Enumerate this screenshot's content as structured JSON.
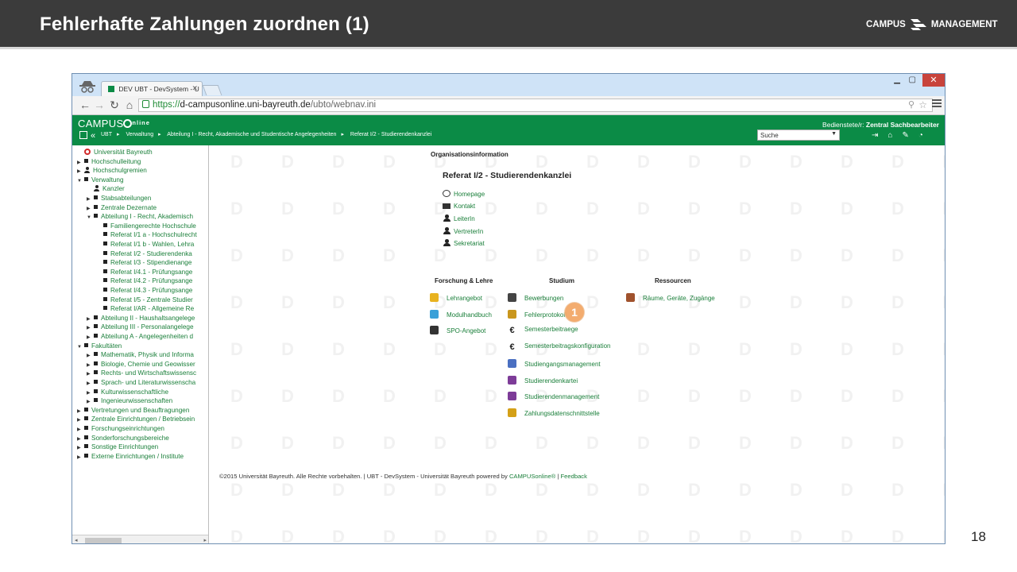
{
  "slide": {
    "title": "Fehlerhafte Zahlungen zuordnen (1)",
    "logo_left": "CAMPUS",
    "logo_right": "MANAGEMENT",
    "page_number": "18"
  },
  "browser": {
    "tab_title": "DEV UBT - DevSystem - U",
    "url_scheme": "https://",
    "url_host": "d-campusonline.uni-bayreuth.de",
    "url_path": "/ubto/webnav.ini"
  },
  "campusonline": {
    "brand": "CAMPUS",
    "brand_suffix": "nline",
    "breadcrumb": [
      "UBT",
      "Verwaltung",
      "Abteilung I - Recht, Akademische und Studentische Angelegenheiten",
      "Referat I/2 - Studierendenkanzlei"
    ],
    "user_role": "Bedienstete/r:",
    "user_name": "Zentral Sachbearbeiter",
    "search_label": "Suche"
  },
  "tree": [
    {
      "label": "Universität Bayreuth",
      "level": 0,
      "icon": "university-logo-icon",
      "toggle": ""
    },
    {
      "label": "Hochschulleitung",
      "level": 0,
      "icon": "square-icon",
      "toggle": "▶"
    },
    {
      "label": "Hochschulgremien",
      "level": 0,
      "icon": "group-icon",
      "toggle": "▶"
    },
    {
      "label": "Verwaltung",
      "level": 0,
      "icon": "square-icon",
      "toggle": "▼"
    },
    {
      "label": "Kanzler",
      "level": 1,
      "icon": "person-icon",
      "toggle": ""
    },
    {
      "label": "Stabsabteilungen",
      "level": 1,
      "icon": "square-icon",
      "toggle": "▶"
    },
    {
      "label": "Zentrale Dezernate",
      "level": 1,
      "icon": "square-icon",
      "toggle": "▶"
    },
    {
      "label": "Abteilung I - Recht, Akademisch",
      "level": 1,
      "icon": "square-icon",
      "toggle": "▼"
    },
    {
      "label": "Familiengerechte Hochschule",
      "level": 2,
      "icon": "square-icon",
      "toggle": ""
    },
    {
      "label": "Referat I/1 a - Hochschulrecht",
      "level": 2,
      "icon": "square-icon",
      "toggle": ""
    },
    {
      "label": "Referat I/1 b - Wahlen, Lehra",
      "level": 2,
      "icon": "square-icon",
      "toggle": ""
    },
    {
      "label": "Referat I/2 - Studierendenka",
      "level": 2,
      "icon": "square-icon",
      "toggle": ""
    },
    {
      "label": "Referat I/3 - Stipendienange",
      "level": 2,
      "icon": "square-icon",
      "toggle": ""
    },
    {
      "label": "Referat I/4.1 - Prüfungsange",
      "level": 2,
      "icon": "square-icon",
      "toggle": ""
    },
    {
      "label": "Referat I/4.2 - Prüfungsange",
      "level": 2,
      "icon": "square-icon",
      "toggle": ""
    },
    {
      "label": "Referat I/4.3 - Prüfungsange",
      "level": 2,
      "icon": "square-icon",
      "toggle": ""
    },
    {
      "label": "Referat I/5 - Zentrale Studier",
      "level": 2,
      "icon": "square-icon",
      "toggle": ""
    },
    {
      "label": "Referat I/AR - Allgemeine Re",
      "level": 2,
      "icon": "square-icon",
      "toggle": ""
    },
    {
      "label": "Abteilung II - Haushaltsangelege",
      "level": 1,
      "icon": "square-icon",
      "toggle": "▶"
    },
    {
      "label": "Abteilung III - Personalangelege",
      "level": 1,
      "icon": "square-icon",
      "toggle": "▶"
    },
    {
      "label": "Abteilung A - Angelegenheiten d",
      "level": 1,
      "icon": "square-icon",
      "toggle": "▶"
    },
    {
      "label": "Fakultäten",
      "level": 0,
      "icon": "square-icon",
      "toggle": "▼"
    },
    {
      "label": "Mathematik, Physik und Informa",
      "level": 1,
      "icon": "square-icon",
      "toggle": "▶"
    },
    {
      "label": "Biologie, Chemie und Geowisser",
      "level": 1,
      "icon": "square-icon",
      "toggle": "▶"
    },
    {
      "label": "Rechts- und Wirtschaftswissensc",
      "level": 1,
      "icon": "square-icon",
      "toggle": "▶"
    },
    {
      "label": "Sprach- und Literaturwissenscha",
      "level": 1,
      "icon": "square-icon",
      "toggle": "▶"
    },
    {
      "label": "Kulturwissenschaftliche",
      "level": 1,
      "icon": "square-icon",
      "toggle": "▶"
    },
    {
      "label": "Ingenieurwissenschaften",
      "level": 1,
      "icon": "square-icon",
      "toggle": "▶"
    },
    {
      "label": "Vertretungen und Beauftragungen",
      "level": 0,
      "icon": "square-icon",
      "toggle": "▶"
    },
    {
      "label": "Zentrale Einrichtungen / Betriebsein",
      "level": 0,
      "icon": "square-icon",
      "toggle": "▶"
    },
    {
      "label": "Forschungseinrichtungen",
      "level": 0,
      "icon": "square-icon",
      "toggle": "▶"
    },
    {
      "label": "Sonderforschungsbereiche",
      "level": 0,
      "icon": "square-icon",
      "toggle": "▶"
    },
    {
      "label": "Sonstige Einrichtungen",
      "level": 0,
      "icon": "square-icon",
      "toggle": "▶"
    },
    {
      "label": "Externe Einrichtungen / Institute",
      "level": 0,
      "icon": "square-icon",
      "toggle": "▶"
    }
  ],
  "org": {
    "heading": "Organisationsinformation",
    "title": "Referat I/2 - Studierendenkanzlei",
    "links": [
      {
        "label": "Homepage",
        "icon": "globe-icon"
      },
      {
        "label": "Kontakt",
        "icon": "mail-icon"
      },
      {
        "label": "LeiterIn",
        "icon": "person-icon"
      },
      {
        "label": "VertreterIn",
        "icon": "person-icon"
      },
      {
        "label": "Sekretariat",
        "icon": "person-icon"
      }
    ]
  },
  "sections": {
    "forschung": {
      "title": "Forschung & Lehre",
      "apps": [
        {
          "label": "Lehrangebot",
          "icon": "teacher-icon",
          "color": "#e8b21f"
        },
        {
          "label": "Modulhandbuch",
          "icon": "cube-icon",
          "color": "#3aa0d8"
        },
        {
          "label": "SPO-Angebot",
          "icon": "tool-icon",
          "color": "#333333"
        }
      ]
    },
    "studium": {
      "title": "Studium",
      "apps": [
        {
          "label": "Bewerbungen",
          "icon": "login-icon",
          "color": "#444444"
        },
        {
          "label": "Fehlerprotokoll",
          "icon": "money-bag-icon",
          "color": "#c9961d"
        },
        {
          "label": "Semesterbeitraege",
          "icon": "euro-icon",
          "color": "#222222"
        },
        {
          "label": "Semesterbeitragskonfiguration",
          "icon": "euro-icon",
          "color": "#222222"
        },
        {
          "label": "Studiengangsmanagement",
          "icon": "chart-icon",
          "color": "#4a6fc1"
        },
        {
          "label": "Studierendenkartei",
          "icon": "student-icon",
          "color": "#7d3c98"
        },
        {
          "label": "Studierendenmanagement",
          "icon": "student-icon",
          "color": "#7d3c98"
        },
        {
          "label": "Zahlungsdatenschnittstelle",
          "icon": "payment-icon",
          "color": "#d4a017"
        }
      ]
    },
    "ressourcen": {
      "title": "Ressourcen",
      "apps": [
        {
          "label": "Räume, Geräte, Zugänge",
          "icon": "building-icon",
          "color": "#a0522d"
        }
      ]
    }
  },
  "footer": {
    "text": "©2015 Universität Bayreuth. Alle Rechte vorbehalten. | UBT - DevSystem - Universität Bayreuth powered by",
    "link1": "CAMPUSonline®",
    "sep": "|",
    "link2": "Feedback"
  },
  "callout": {
    "label": "1"
  }
}
